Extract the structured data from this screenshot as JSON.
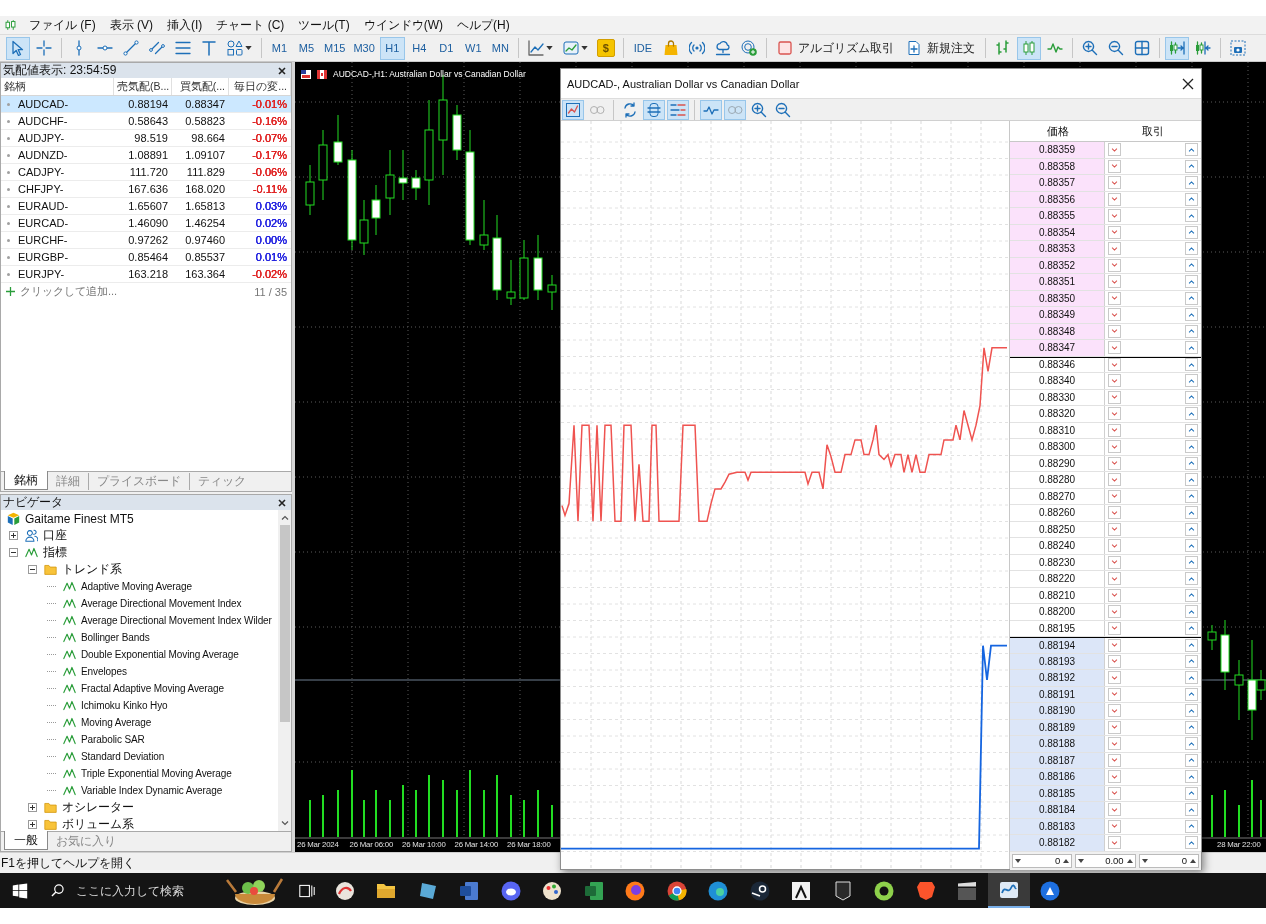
{
  "menu": {
    "items": [
      "ファイル (F)",
      "表示 (V)",
      "挿入(I)",
      "チャート (C)",
      "ツール(T)",
      "ウインドウ(W)",
      "ヘルプ(H)"
    ]
  },
  "toolbar": {
    "cursor_tools": [
      {
        "on": true
      },
      {
        "on": false
      }
    ],
    "timeframes": [
      {
        "label": "M1",
        "selected": false
      },
      {
        "label": "M5",
        "selected": false
      },
      {
        "label": "M15",
        "selected": false
      },
      {
        "label": "M30",
        "selected": false
      },
      {
        "label": "H1",
        "selected": true
      },
      {
        "label": "H4",
        "selected": false
      },
      {
        "label": "D1",
        "selected": false
      },
      {
        "label": "W1",
        "selected": false
      },
      {
        "label": "MN",
        "selected": false
      }
    ],
    "currency_button": "$",
    "ide_button": "IDE",
    "algo_trading": {
      "label": "アルゴリズム取引",
      "on": false
    },
    "new_order": "新規注文",
    "chart_types": [
      {
        "on": false
      },
      {
        "on": true
      },
      {
        "on": false
      }
    ],
    "auto_scroll": true,
    "chart_shift": false
  },
  "market_watch": {
    "title": "気配値表示: 23:54:59",
    "columns": [
      "銘柄",
      "売気配(B...",
      "買気配(...",
      "毎日の変..."
    ],
    "rows": [
      {
        "symbol": "AUDCAD-",
        "bid": "0.88194",
        "ask": "0.88347",
        "change": "-0.01%",
        "color": "#e02424",
        "selected": true
      },
      {
        "symbol": "AUDCHF-",
        "bid": "0.58643",
        "ask": "0.58823",
        "change": "-0.16%",
        "color": "#e02424",
        "selected": false
      },
      {
        "symbol": "AUDJPY-",
        "bid": "98.519",
        "ask": "98.664",
        "change": "-0.07%",
        "color": "#e02424",
        "selected": false
      },
      {
        "symbol": "AUDNZD-",
        "bid": "1.08891",
        "ask": "1.09107",
        "change": "-0.17%",
        "color": "#e02424",
        "selected": false
      },
      {
        "symbol": "CADJPY-",
        "bid": "111.720",
        "ask": "111.829",
        "change": "-0.06%",
        "color": "#e02424",
        "selected": false
      },
      {
        "symbol": "CHFJPY-",
        "bid": "167.636",
        "ask": "168.020",
        "change": "-0.11%",
        "color": "#e02424",
        "selected": false
      },
      {
        "symbol": "EURAUD-",
        "bid": "1.65607",
        "ask": "1.65813",
        "change": "0.03%",
        "color": "#2424e0",
        "selected": false
      },
      {
        "symbol": "EURCAD-",
        "bid": "1.46090",
        "ask": "1.46254",
        "change": "0.02%",
        "color": "#2424e0",
        "selected": false
      },
      {
        "symbol": "EURCHF-",
        "bid": "0.97262",
        "ask": "0.97460",
        "change": "0.00%",
        "color": "#2424e0",
        "selected": false
      },
      {
        "symbol": "EURGBP-",
        "bid": "0.85464",
        "ask": "0.85537",
        "change": "0.01%",
        "color": "#2424e0",
        "selected": false
      },
      {
        "symbol": "EURJPY-",
        "bid": "163.218",
        "ask": "163.364",
        "change": "-0.02%",
        "color": "#e02424",
        "selected": false
      }
    ],
    "add_prompt": "クリックして追加...",
    "count": "11 / 35",
    "tabs": [
      {
        "label": "銘柄",
        "selected": true
      },
      {
        "label": "詳細",
        "selected": false
      },
      {
        "label": "プライスボード",
        "selected": false
      },
      {
        "label": "ティック",
        "selected": false
      }
    ]
  },
  "navigator": {
    "title": "ナビゲータ",
    "tree": [
      {
        "label": "Gaitame Finest MT5",
        "kind": "broker",
        "children": [
          {
            "label": "口座",
            "kind": "accounts",
            "expanded": false
          },
          {
            "label": "指標",
            "kind": "indicators",
            "expanded": true,
            "children": [
              {
                "label": "トレンド系",
                "kind": "folder",
                "expanded": true,
                "children": [
                  {
                    "label": "Adaptive Moving Average",
                    "kind": "indicator"
                  },
                  {
                    "label": "Average Directional Movement Index",
                    "kind": "indicator"
                  },
                  {
                    "label": "Average Directional Movement Index Wilder",
                    "kind": "indicator"
                  },
                  {
                    "label": "Bollinger Bands",
                    "kind": "indicator"
                  },
                  {
                    "label": "Double Exponential Moving Average",
                    "kind": "indicator"
                  },
                  {
                    "label": "Envelopes",
                    "kind": "indicator"
                  },
                  {
                    "label": "Fractal Adaptive Moving Average",
                    "kind": "indicator"
                  },
                  {
                    "label": "Ichimoku Kinko Hyo",
                    "kind": "indicator"
                  },
                  {
                    "label": "Moving Average",
                    "kind": "indicator"
                  },
                  {
                    "label": "Parabolic SAR",
                    "kind": "indicator"
                  },
                  {
                    "label": "Standard Deviation",
                    "kind": "indicator"
                  },
                  {
                    "label": "Triple Exponential Moving Average",
                    "kind": "indicator"
                  },
                  {
                    "label": "Variable Index Dynamic Average",
                    "kind": "indicator"
                  }
                ]
              },
              {
                "label": "オシレーター",
                "kind": "folder",
                "expanded": false
              },
              {
                "label": "ボリューム系",
                "kind": "folder",
                "expanded": false
              }
            ]
          }
        ]
      }
    ],
    "tabs": [
      {
        "label": "一般",
        "selected": true
      },
      {
        "label": "お気に入り",
        "selected": false
      }
    ]
  },
  "chart": {
    "title": "AUDCAD-,H1: Australian Dollar vs Canadian Dollar",
    "time_labels": [
      "26 Mar 2024",
      "26 Mar 06:00",
      "26 Mar 10:00",
      "26 Mar 14:00",
      "26 Mar 18:00"
    ],
    "far_right_time_label": "28 Mar 22:00"
  },
  "depth_of_market": {
    "title": "AUDCAD-, Australian Dollar vs Canadian Dollar",
    "toolbar": [
      {
        "on": true,
        "disabled": false
      },
      {
        "on": false,
        "disabled": true
      },
      {
        "on": false,
        "disabled": false
      },
      {
        "on": true,
        "disabled": false
      },
      {
        "on": true,
        "disabled": false
      },
      {
        "on": true,
        "disabled": false
      },
      {
        "on": true,
        "disabled": true
      },
      {
        "on": false,
        "disabled": false
      },
      {
        "on": false,
        "disabled": false
      }
    ],
    "columns": [
      "価格",
      "取引"
    ],
    "rows": [
      {
        "price": "0.88359",
        "kind": "ask"
      },
      {
        "price": "0.88358",
        "kind": "ask"
      },
      {
        "price": "0.88357",
        "kind": "ask"
      },
      {
        "price": "0.88356",
        "kind": "ask"
      },
      {
        "price": "0.88355",
        "kind": "ask"
      },
      {
        "price": "0.88354",
        "kind": "ask"
      },
      {
        "price": "0.88353",
        "kind": "ask"
      },
      {
        "price": "0.88352",
        "kind": "ask"
      },
      {
        "price": "0.88351",
        "kind": "ask"
      },
      {
        "price": "0.88350",
        "kind": "ask"
      },
      {
        "price": "0.88349",
        "kind": "ask"
      },
      {
        "price": "0.88348",
        "kind": "ask"
      },
      {
        "price": "0.88347",
        "kind": "ask"
      },
      {
        "price": "0.88346",
        "kind": "mid"
      },
      {
        "price": "0.88340",
        "kind": "mid"
      },
      {
        "price": "0.88330",
        "kind": "mid"
      },
      {
        "price": "0.88320",
        "kind": "mid"
      },
      {
        "price": "0.88310",
        "kind": "mid"
      },
      {
        "price": "0.88300",
        "kind": "mid"
      },
      {
        "price": "0.88290",
        "kind": "mid"
      },
      {
        "price": "0.88280",
        "kind": "mid"
      },
      {
        "price": "0.88270",
        "kind": "mid"
      },
      {
        "price": "0.88260",
        "kind": "mid"
      },
      {
        "price": "0.88250",
        "kind": "mid"
      },
      {
        "price": "0.88240",
        "kind": "mid"
      },
      {
        "price": "0.88230",
        "kind": "mid"
      },
      {
        "price": "0.88220",
        "kind": "mid"
      },
      {
        "price": "0.88210",
        "kind": "mid"
      },
      {
        "price": "0.88200",
        "kind": "mid"
      },
      {
        "price": "0.88195",
        "kind": "mid"
      },
      {
        "price": "0.88194",
        "kind": "bid"
      },
      {
        "price": "0.88193",
        "kind": "bid"
      },
      {
        "price": "0.88192",
        "kind": "bid"
      },
      {
        "price": "0.88191",
        "kind": "bid"
      },
      {
        "price": "0.88190",
        "kind": "bid"
      },
      {
        "price": "0.88189",
        "kind": "bid"
      },
      {
        "price": "0.88188",
        "kind": "bid"
      },
      {
        "price": "0.88187",
        "kind": "bid"
      },
      {
        "price": "0.88186",
        "kind": "bid"
      },
      {
        "price": "0.88185",
        "kind": "bid"
      },
      {
        "price": "0.88184",
        "kind": "bid"
      },
      {
        "price": "0.88183",
        "kind": "bid"
      },
      {
        "price": "0.88182",
        "kind": "bid"
      }
    ],
    "spinners": [
      "0",
      "0.00",
      "0"
    ]
  },
  "status_bar": {
    "text": "F1を押してヘルプを開く"
  },
  "taskbar": {
    "search_placeholder": "ここに入力して検索",
    "apps": [
      {
        "active": false
      },
      {
        "active": false
      },
      {
        "active": false
      },
      {
        "active": false
      },
      {
        "active": false
      },
      {
        "active": false
      },
      {
        "active": false
      },
      {
        "active": false
      },
      {
        "active": false
      },
      {
        "active": false
      },
      {
        "active": false
      },
      {
        "active": false
      },
      {
        "active": false
      },
      {
        "active": false
      },
      {
        "active": false
      },
      {
        "active": false
      },
      {
        "active": true
      },
      {
        "active": false
      }
    ]
  }
}
